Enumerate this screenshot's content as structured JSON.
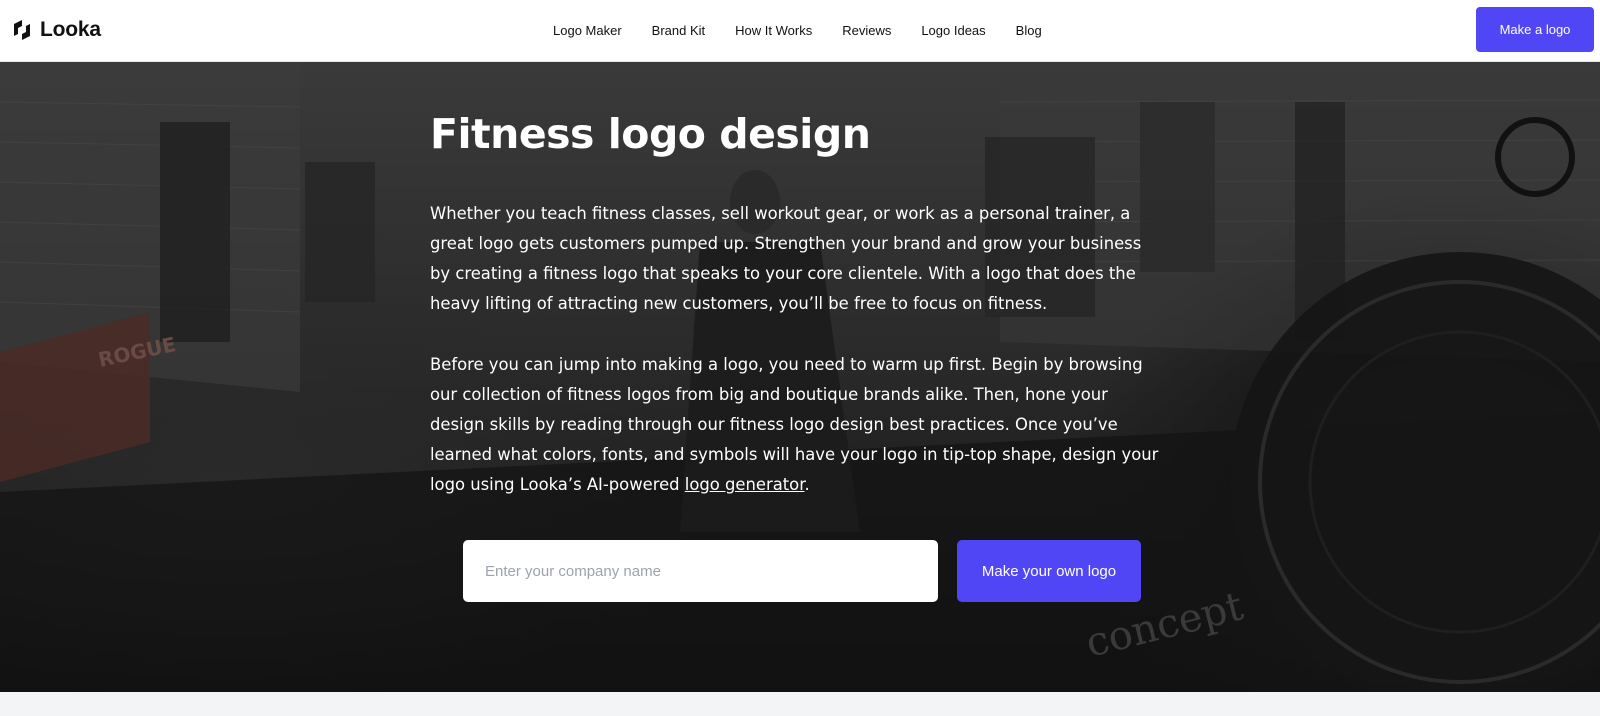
{
  "header": {
    "brand_name": "Looka",
    "nav_items": [
      {
        "label": "Logo Maker"
      },
      {
        "label": "Brand Kit"
      },
      {
        "label": "How It Works"
      },
      {
        "label": "Reviews"
      },
      {
        "label": "Logo Ideas"
      },
      {
        "label": "Blog"
      }
    ],
    "cta_label": "Make a logo"
  },
  "hero": {
    "title": "Fitness logo design",
    "paragraph1": "Whether you teach fitness classes, sell workout gear, or work as a personal trainer, a great logo gets customers pumped up. Strengthen your brand and grow your business by creating a fitness logo that speaks to your core clientele. With a logo that does the heavy lifting of attracting new customers, you’ll be free to focus on fitness.",
    "paragraph2_text": "Before you can jump into making a logo, you need to warm up first. Begin by browsing our collection of fitness logos from big and boutique brands alike. Then, hone your design skills by reading through our fitness logo design best practices. Once you’ve learned what colors, fonts, and symbols will have your logo in tip-top shape, design your logo using Looka’s AI-powered ",
    "paragraph2_link": "logo generator",
    "paragraph2_end": ".",
    "background_text_rogue": "ROGUE",
    "background_text_concept": "concept"
  },
  "form": {
    "input_placeholder": "Enter your company name",
    "input_value": "",
    "button_label": "Make your own logo"
  },
  "colors": {
    "accent": "#5046f5",
    "header_bg": "#ffffff",
    "hero_text": "#ffffff"
  },
  "icons": {
    "brand_icon": "looka-logo-icon"
  }
}
